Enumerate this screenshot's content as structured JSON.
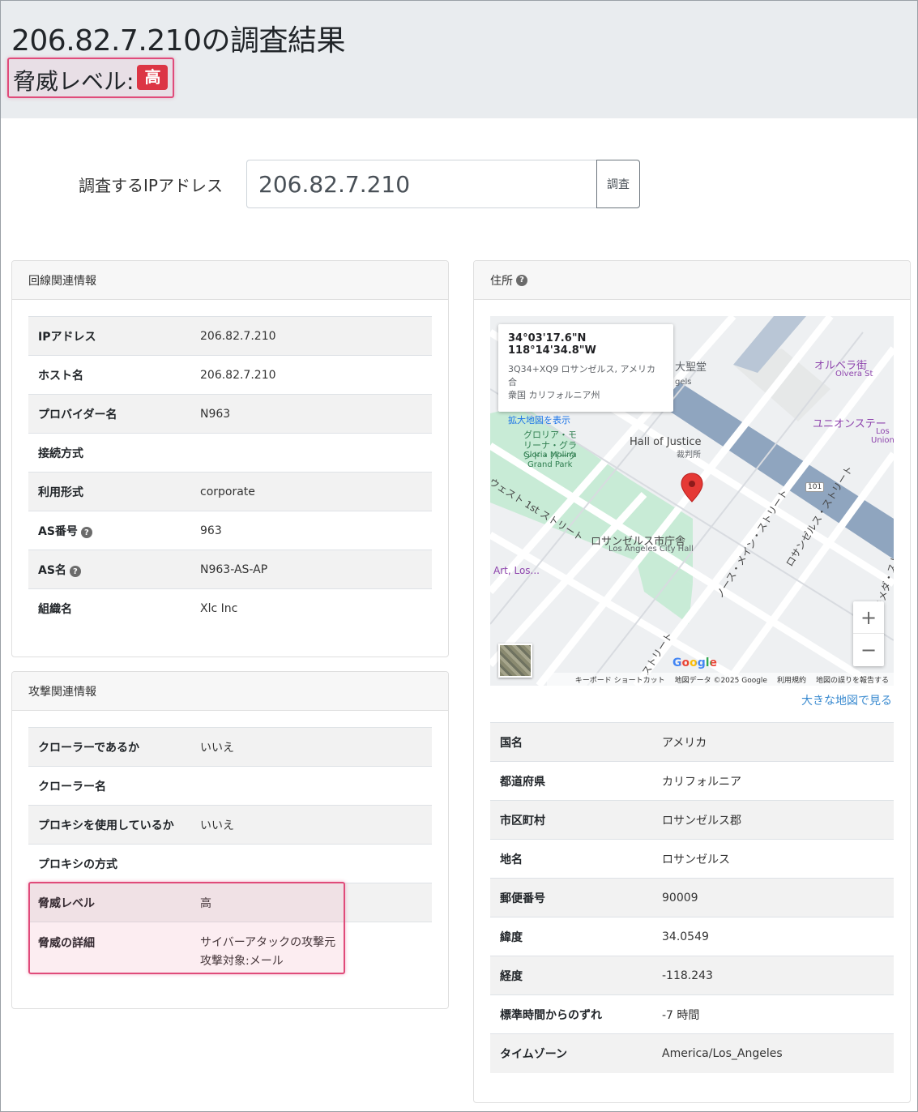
{
  "header": {
    "title": "206.82.7.210の調査結果",
    "threat_label": "脅威レベル:",
    "threat_badge": "高"
  },
  "search": {
    "label": "調査するIPアドレス",
    "value": "206.82.7.210",
    "button": "調査"
  },
  "line_info": {
    "title": "回線関連情報",
    "rows": [
      {
        "key": "IPアドレス",
        "value": "206.82.7.210"
      },
      {
        "key": "ホスト名",
        "value": "206.82.7.210"
      },
      {
        "key": "プロバイダー名",
        "value": "N963"
      },
      {
        "key": "接続方式",
        "value": ""
      },
      {
        "key": "利用形式",
        "value": "corporate"
      },
      {
        "key": "AS番号",
        "value": "963"
      },
      {
        "key": "AS名",
        "value": "N963-AS-AP"
      },
      {
        "key": "組織名",
        "value": "Xlc Inc"
      }
    ]
  },
  "attack_info": {
    "title": "攻撃関連情報",
    "rows": [
      {
        "key": "クローラーであるか",
        "value": "いいえ"
      },
      {
        "key": "クローラー名",
        "value": ""
      },
      {
        "key": "プロキシを使用しているか",
        "value": "いいえ"
      },
      {
        "key": "プロキシの方式",
        "value": ""
      },
      {
        "key": "脅威レベル",
        "value": "高"
      },
      {
        "key": "脅威の詳細",
        "value": "サイバーアタックの攻撃元",
        "value2": "攻撃対象:メール"
      }
    ]
  },
  "address": {
    "title": "住所",
    "map": {
      "coord": "34°03'17.6\"N 118°14'34.8\"W",
      "addr_line1": "3Q34+XQ9 ロサンゼルス, アメリカ合",
      "addr_line2": "衆国 カリフォルニア州",
      "enlarge_link": "拡大地図を表示",
      "labels": {
        "cathedral": "大聖堂",
        "cathedral_en": "gels",
        "olvera": "オルベラ街",
        "olvera_en": "Olvera St",
        "union": "ユニオンステー",
        "union_en1": "Los",
        "union_en2": "Union",
        "justice": "Hall of Justice",
        "justice_ja": "裁判所",
        "gloria": "グロリア・モリーナ・グランド・パーク",
        "gloria_en1": "Gloria Molina",
        "gloria_en2": "Grand Park",
        "first_st": "ウェスト 1st ストリート",
        "city_hall": "ロサンゼルス市庁舎",
        "city_hall_en": "Los Angeles City Hall",
        "art": "Art, Los...",
        "main_st": "ノース・メイン・ストリート",
        "la_st": "ロサンゼルス・ストリート",
        "alameda": "アラメダ・ストリート",
        "street": "ストリート",
        "hwy": "101"
      },
      "zoom_in": "+",
      "zoom_out": "−",
      "google": "Google",
      "footer": [
        "キーボード ショートカット",
        "地図データ ©2025 Google",
        "利用規約",
        "地図の誤りを報告する"
      ]
    },
    "big_map_link": "大きな地図で見る",
    "rows": [
      {
        "key": "国名",
        "value": "アメリカ"
      },
      {
        "key": "都道府県",
        "value": "カリフォルニア"
      },
      {
        "key": "市区町村",
        "value": "ロサンゼルス郡"
      },
      {
        "key": "地名",
        "value": "ロサンゼルス"
      },
      {
        "key": "郵便番号",
        "value": "90009"
      },
      {
        "key": "緯度",
        "value": "34.0549"
      },
      {
        "key": "経度",
        "value": "-118.243"
      },
      {
        "key": "標準時間からのずれ",
        "value": "-7 時間"
      },
      {
        "key": "タイムゾーン",
        "value": "America/Los_Angeles"
      }
    ]
  },
  "help_icon": "?"
}
